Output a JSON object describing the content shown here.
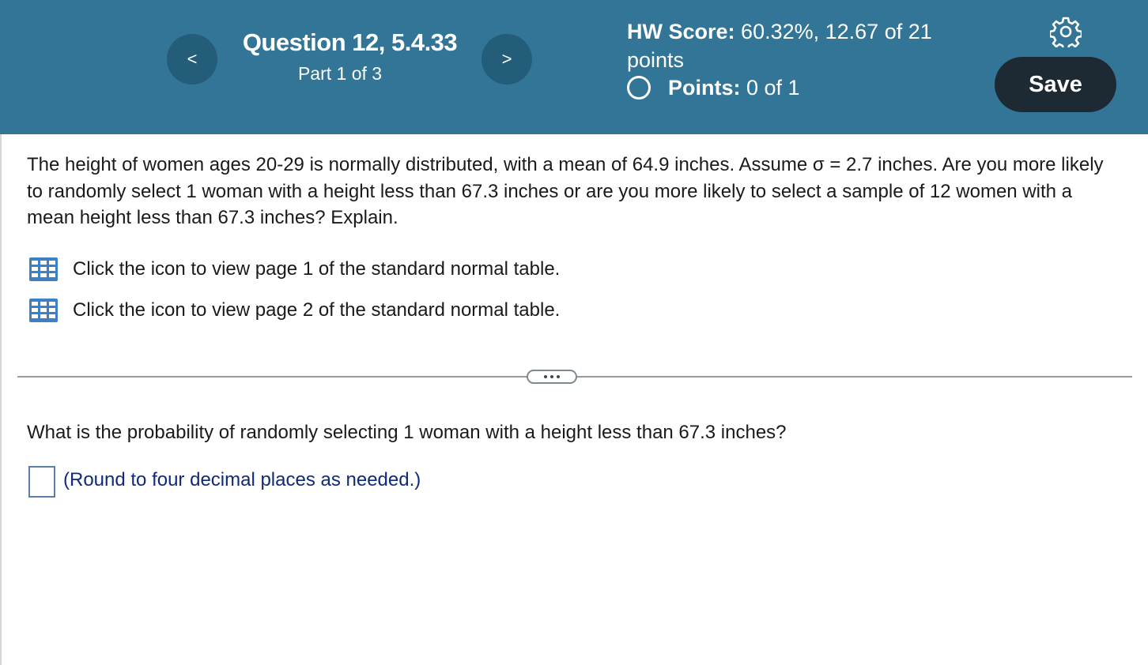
{
  "header": {
    "prev_label": "<",
    "next_label": ">",
    "question_title": "Question 12, 5.4.33",
    "part_label": "Part 1 of 3",
    "hw_score_label": "HW Score:",
    "hw_score_value": "60.32%, 12.67 of 21 points",
    "points_label": "Points:",
    "points_value": "0 of 1",
    "save_label": "Save",
    "settings_icon": "gear-icon",
    "status_icon": "circle-icon"
  },
  "colors": {
    "header_bg": "#337596",
    "nav_button": "#235d79",
    "save_button": "#1d2a34",
    "note_text": "#0f2a78"
  },
  "question": {
    "text": "The height of women ages 20-29 is normally distributed, with a mean of 64.9 inches. Assume σ = 2.7 inches. Are you more likely to randomly select 1 woman with a height less than 67.3 inches or are you more likely to select a sample of 12 women with a mean height less than 67.3 inches? Explain.",
    "links": [
      {
        "label": "Click the icon to view page 1 of the standard normal table.",
        "icon": "table-icon"
      },
      {
        "label": "Click the icon to view page 2 of the standard normal table.",
        "icon": "table-icon"
      }
    ]
  },
  "part": {
    "sub_question": "What is the probability of randomly selecting 1 woman with a height less than 67.3 inches?",
    "answer_value": "",
    "round_note": "(Round to four decimal places as needed.)"
  }
}
